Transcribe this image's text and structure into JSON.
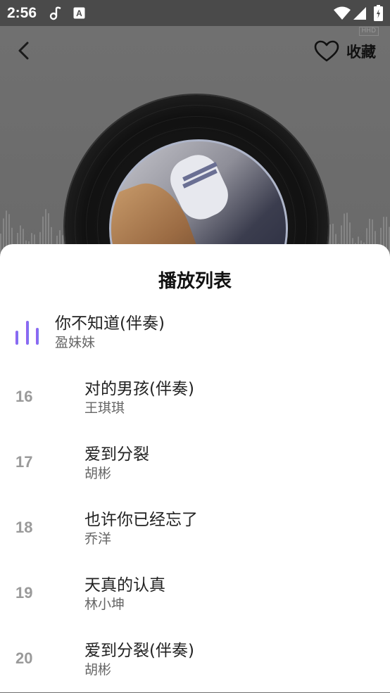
{
  "status_bar": {
    "time": "2:56",
    "icons": [
      "notification-app-icon",
      "notification-a-icon",
      "wifi-icon",
      "signal-icon",
      "battery-icon"
    ]
  },
  "header": {
    "favorite_label": "收藏",
    "hd_badge": "HHD",
    "back_icon": "back-arrow-icon",
    "favorite_icon": "heart-outline-icon"
  },
  "playlist": {
    "title": "播放列表",
    "accent_colors": [
      "#a05cf0",
      "#6f7bf2"
    ],
    "current": {
      "title": "你不知道(伴奏)",
      "artist": "盈妹妹"
    },
    "items": [
      {
        "index": "16",
        "title": "对的男孩(伴奏)",
        "artist": "王琪琪"
      },
      {
        "index": "17",
        "title": "爱到分裂",
        "artist": "胡彬"
      },
      {
        "index": "18",
        "title": "也许你已经忘了",
        "artist": " 乔洋"
      },
      {
        "index": "19",
        "title": "天真的认真",
        "artist": "林小坤"
      },
      {
        "index": "20",
        "title": "爱到分裂(伴奏)",
        "artist": "胡彬"
      }
    ]
  }
}
